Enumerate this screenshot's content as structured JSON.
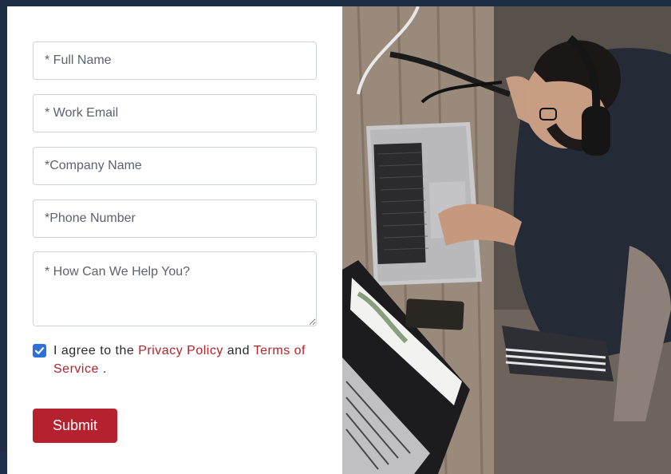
{
  "form": {
    "full_name_placeholder": "* Full Name",
    "work_email_placeholder": "* Work Email",
    "company_placeholder": "*Company Name",
    "phone_placeholder": "*Phone Number",
    "help_placeholder": "* How Can We Help You?",
    "agree_checked": true,
    "agree_prefix": "I agree to the",
    "privacy_link": "Privacy Policy",
    "agree_and": "and",
    "terms_link": "Terms of Service",
    "agree_suffix": ".",
    "submit_label": "Submit"
  },
  "colors": {
    "accent": "#b5212e",
    "link": "#b1232b",
    "checkbox": "#2f6fdc",
    "page_background": "#1f2d44"
  },
  "icons": {
    "checkbox": "check-icon"
  }
}
